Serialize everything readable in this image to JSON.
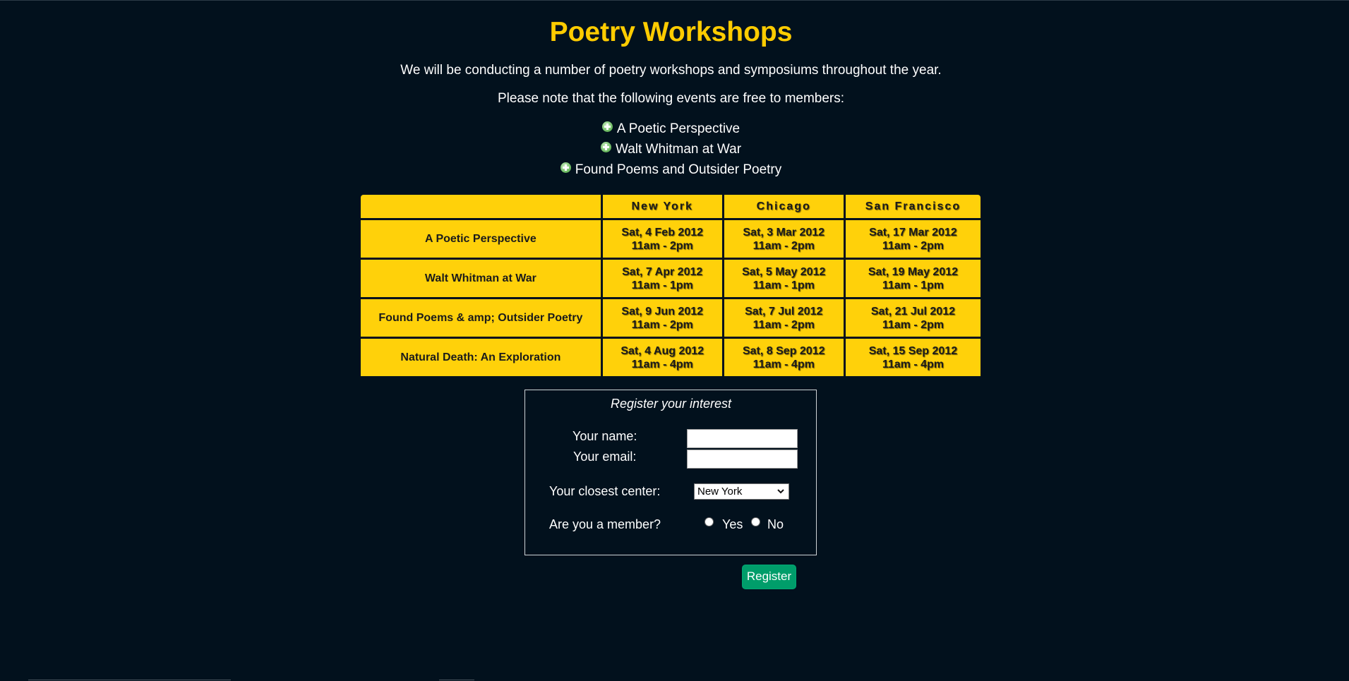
{
  "page": {
    "title": "Poetry Workshops",
    "intro_1": "We will be conducting a number of poetry workshops and symposiums throughout the year.",
    "intro_2": "Please note that the following events are free to members:"
  },
  "free_events": [
    "A Poetic Perspective",
    "Walt Whitman at War",
    "Found Poems and Outsider Poetry"
  ],
  "schedule": {
    "headers": [
      "",
      "New York",
      "Chicago",
      "San Francisco"
    ],
    "rows": [
      {
        "event": "A Poetic Perspective",
        "cells": [
          {
            "date": "Sat, 4 Feb 2012",
            "time": "11am - 2pm"
          },
          {
            "date": "Sat, 3 Mar 2012",
            "time": "11am - 2pm"
          },
          {
            "date": "Sat, 17 Mar 2012",
            "time": "11am - 2pm"
          }
        ]
      },
      {
        "event": "Walt Whitman at War",
        "cells": [
          {
            "date": "Sat, 7 Apr 2012",
            "time": "11am - 1pm"
          },
          {
            "date": "Sat, 5 May 2012",
            "time": "11am - 1pm"
          },
          {
            "date": "Sat, 19 May 2012",
            "time": "11am - 1pm"
          }
        ]
      },
      {
        "event": "Found Poems & amp; Outsider Poetry",
        "cells": [
          {
            "date": "Sat, 9 Jun 2012",
            "time": "11am - 2pm"
          },
          {
            "date": "Sat, 7 Jul 2012",
            "time": "11am - 2pm"
          },
          {
            "date": "Sat, 21 Jul 2012",
            "time": "11am - 2pm"
          }
        ]
      },
      {
        "event": "Natural Death: An Exploration",
        "cells": [
          {
            "date": "Sat, 4 Aug 2012",
            "time": "11am - 4pm"
          },
          {
            "date": "Sat, 8 Sep 2012",
            "time": "11am - 4pm"
          },
          {
            "date": "Sat, 15 Sep 2012",
            "time": "11am - 4pm"
          }
        ]
      }
    ]
  },
  "form": {
    "legend": "Register your interest",
    "name_label": "Your name:",
    "name_value": "",
    "email_label": "Your email:",
    "email_value": "",
    "center_label": "Your closest center:",
    "center_selected": "New York",
    "member_label": "Are you a member?",
    "member_yes": "Yes",
    "member_no": "No",
    "submit_label": "Register"
  },
  "colors": {
    "background": "#02111d",
    "accent": "#ffcc00",
    "table_cell": "#ffd10a",
    "button": "#009d6a"
  },
  "icons": {
    "event_bullet": "green-plus-circle-icon",
    "select_arrow": "chevron-down-icon"
  }
}
